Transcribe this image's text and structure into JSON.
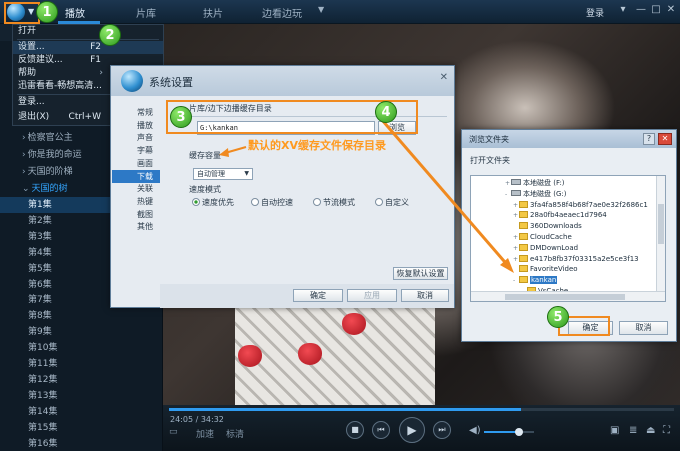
{
  "topbar": {
    "tabs": [
      {
        "label": "播放"
      },
      {
        "label": "片库"
      },
      {
        "label": "扶片"
      },
      {
        "label": "边看边玩"
      }
    ],
    "login_label": "登录"
  },
  "menu": {
    "items": [
      {
        "label": "打开",
        "shortcut": ""
      },
      {
        "label": "设置...",
        "shortcut": "F2"
      },
      {
        "label": "反馈建议...",
        "shortcut": "F1"
      },
      {
        "label": "帮助",
        "shortcut": "›"
      },
      {
        "label": "迅雷看看-畅想高清...",
        "shortcut": ""
      },
      {
        "label": "登录...",
        "shortcut": ""
      },
      {
        "label": "退出(X)",
        "shortcut": "Ctrl+W"
      }
    ]
  },
  "sidebar": {
    "folders": [
      {
        "label": "检察官公主",
        "open": false
      },
      {
        "label": "你是我的命运",
        "open": false
      },
      {
        "label": "天国的阶梯",
        "open": false
      },
      {
        "label": "天国的树",
        "open": true
      }
    ],
    "episodes": [
      "第1集",
      "第2集",
      "第3集",
      "第4集",
      "第5集",
      "第6集",
      "第7集",
      "第8集",
      "第9集",
      "第10集",
      "第11集",
      "第12集",
      "第13集",
      "第14集",
      "第15集",
      "第16集"
    ]
  },
  "player": {
    "time": "24:05 / 34:32",
    "progress": 0.697,
    "volume": 0.7,
    "speed_label": "加速",
    "quality_label": "标清"
  },
  "settings_dialog": {
    "title": "系统设置",
    "nav": [
      "常规",
      "播放",
      "声音",
      "字幕",
      "画面",
      "下载",
      "关联",
      "热键",
      "截图",
      "其他"
    ],
    "cache_dir_label": "片库/边下边播缓存目录",
    "cache_path": "G:\\kankan",
    "browse_label": "浏览",
    "cache_size_label": "缓存容量",
    "cache_size_value": "自动管理",
    "speed_mode_label": "速度模式",
    "speed_options": [
      "速度优先",
      "自动控速",
      "节流模式",
      "自定义"
    ],
    "restore_default_label": "恢复默认设置",
    "ok_label": "确定",
    "apply_label": "应用",
    "cancel_label": "取消"
  },
  "browse_dialog": {
    "title": "浏览文件夹",
    "prompt": "打开文件夹",
    "tree": [
      {
        "label": "本地磁盘 (F:)",
        "type": "drive",
        "indent": 0,
        "exp": "+"
      },
      {
        "label": "本地磁盘 (G:)",
        "type": "drive",
        "indent": 0,
        "exp": "-"
      },
      {
        "label": "3fa4fa858f4b68f7ae0e32f2686c1",
        "type": "folder",
        "indent": 1,
        "exp": "+"
      },
      {
        "label": "28a0fb4aeaec1d7964",
        "type": "folder",
        "indent": 1,
        "exp": "+"
      },
      {
        "label": "360Downloads",
        "type": "folder",
        "indent": 1,
        "exp": ""
      },
      {
        "label": "CloudCache",
        "type": "folder",
        "indent": 1,
        "exp": "+"
      },
      {
        "label": "DMDownLoad",
        "type": "folder",
        "indent": 1,
        "exp": "+"
      },
      {
        "label": "e417b8fb37f03315a2e5ce3f13",
        "type": "folder",
        "indent": 1,
        "exp": "+"
      },
      {
        "label": "FavoriteVideo",
        "type": "folder",
        "indent": 1,
        "exp": ""
      },
      {
        "label": "kankan",
        "type": "folder",
        "indent": 1,
        "exp": "-",
        "selected": true
      },
      {
        "label": "VsCache",
        "type": "folder",
        "indent": 2,
        "exp": ""
      }
    ],
    "ok_label": "确定",
    "cancel_label": "取消"
  },
  "annotations": {
    "caption": "默认的XV缓存文件保存目录",
    "numbers": [
      "1",
      "2",
      "3",
      "4",
      "5"
    ],
    "color": "#f08a20"
  }
}
